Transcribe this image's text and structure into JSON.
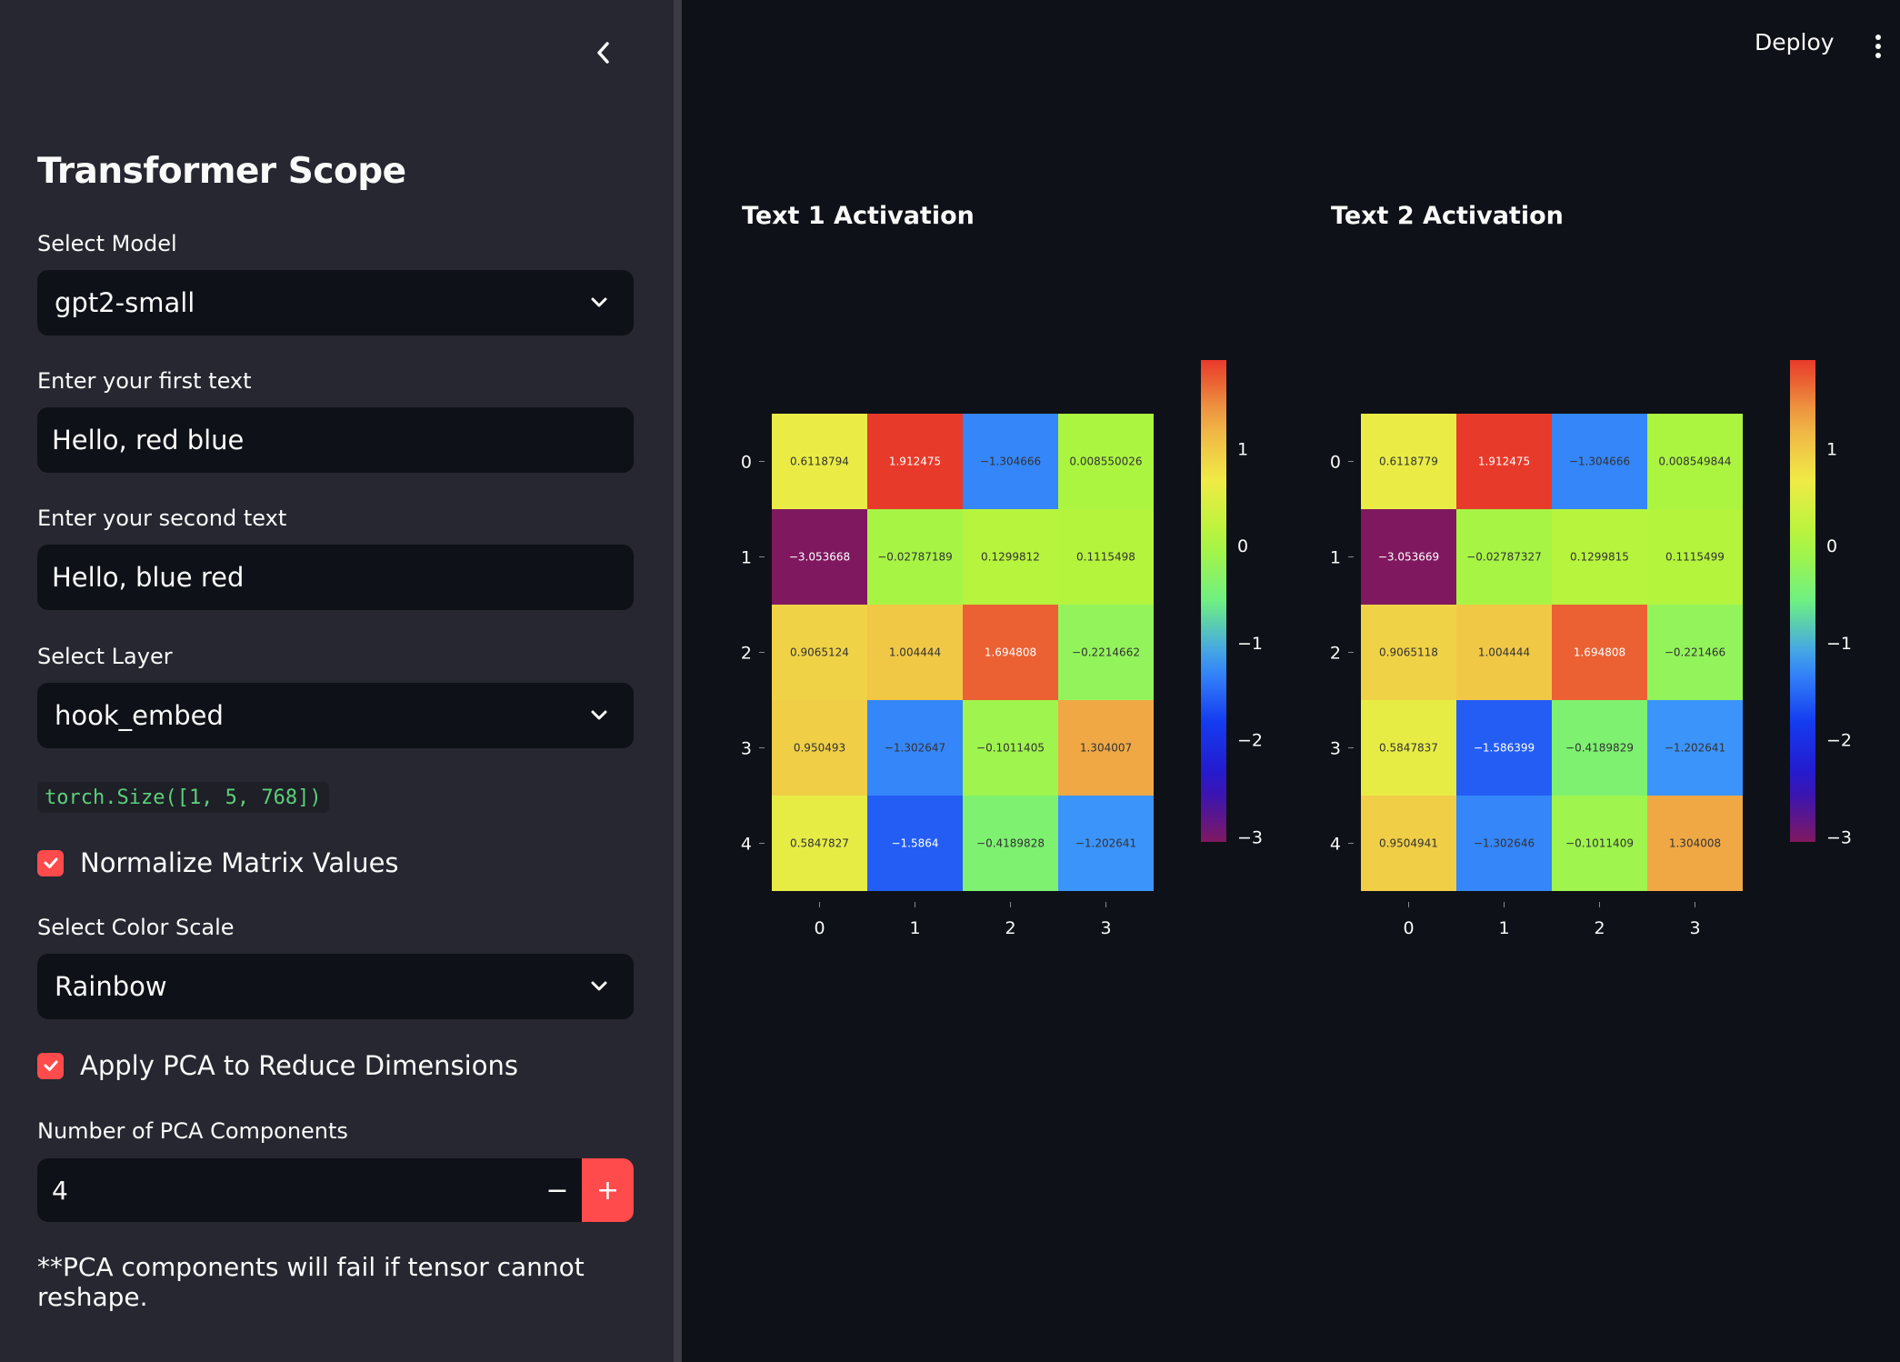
{
  "sidebar": {
    "title": "Transformer Scope",
    "model_label": "Select Model",
    "model_value": "gpt2-small",
    "text1_label": "Enter your first text",
    "text1_value": "Hello, red blue",
    "text2_label": "Enter your second text",
    "text2_value": "Hello, blue red",
    "layer_label": "Select Layer",
    "layer_value": "hook_embed",
    "shape_code": "torch.Size([1, 5, 768])",
    "normalize_label": "Normalize Matrix Values",
    "normalize_checked": true,
    "colorscale_label": "Select Color Scale",
    "colorscale_value": "Rainbow",
    "pca_label": "Apply PCA to Reduce Dimensions",
    "pca_checked": true,
    "pca_components_label": "Number of PCA Components",
    "pca_components_value": "4",
    "stepper_minus": "−",
    "stepper_plus": "+",
    "pca_note": "**PCA components will fail if tensor cannot reshape."
  },
  "header": {
    "deploy_label": "Deploy"
  },
  "colors": {
    "accent": "#ff4b4b",
    "sidebar_bg": "#262730",
    "main_bg": "#0e1117"
  },
  "chart_data": [
    {
      "type": "heatmap",
      "title": "Text 1 Activation",
      "x": [
        0,
        1,
        2,
        3
      ],
      "y": [
        0,
        1,
        2,
        3,
        4
      ],
      "z": [
        [
          0.6118794,
          1.912475,
          -1.304666,
          0.008550026
        ],
        [
          -3.053668,
          -0.02787189,
          0.1299812,
          0.1115498
        ],
        [
          0.9065124,
          1.004444,
          1.694808,
          -0.2214662
        ],
        [
          0.950493,
          -1.302647,
          -0.1011405,
          1.304007
        ],
        [
          0.5847827,
          -1.5864,
          -0.4189828,
          -1.202641
        ]
      ],
      "z_labels": [
        [
          "0.6118794",
          "1.912475",
          "−1.304666",
          "0.008550026"
        ],
        [
          "−3.053668",
          "−0.02787189",
          "0.1299812",
          "0.1115498"
        ],
        [
          "0.9065124",
          "1.004444",
          "1.694808",
          "−0.2214662"
        ],
        [
          "0.950493",
          "−1.302647",
          "−0.1011405",
          "1.304007"
        ],
        [
          "0.5847827",
          "−1.5864",
          "−0.4189828",
          "−1.202641"
        ]
      ],
      "colorscale": "Rainbow",
      "zrange": [
        -3.053668,
        1.912475
      ],
      "colorbar_ticks": [
        1,
        0,
        -1,
        -2,
        -3
      ],
      "colorbar_tick_labels": [
        "1",
        "0",
        "−1",
        "−2",
        "−3"
      ]
    },
    {
      "type": "heatmap",
      "title": "Text 2 Activation",
      "x": [
        0,
        1,
        2,
        3
      ],
      "y": [
        0,
        1,
        2,
        3,
        4
      ],
      "z": [
        [
          0.6118779,
          1.912475,
          -1.304666,
          0.008549844
        ],
        [
          -3.053669,
          -0.02787327,
          0.1299815,
          0.1115499
        ],
        [
          0.9065118,
          1.004444,
          1.694808,
          -0.221466
        ],
        [
          0.5847837,
          -1.586399,
          -0.4189829,
          -1.202641
        ],
        [
          0.9504941,
          -1.302646,
          -0.1011409,
          1.304008
        ]
      ],
      "z_labels": [
        [
          "0.6118779",
          "1.912475",
          "−1.304666",
          "0.008549844"
        ],
        [
          "−3.053669",
          "−0.02787327",
          "0.1299815",
          "0.1115499"
        ],
        [
          "0.9065118",
          "1.004444",
          "1.694808",
          "−0.221466"
        ],
        [
          "0.5847837",
          "−1.586399",
          "−0.4189829",
          "−1.202641"
        ],
        [
          "0.9504941",
          "−1.302646",
          "−0.1011409",
          "1.304008"
        ]
      ],
      "colorscale": "Rainbow",
      "zrange": [
        -3.053669,
        1.912475
      ],
      "colorbar_ticks": [
        1,
        0,
        -1,
        -2,
        -3
      ],
      "colorbar_tick_labels": [
        "1",
        "0",
        "−1",
        "−2",
        "−3"
      ]
    }
  ]
}
